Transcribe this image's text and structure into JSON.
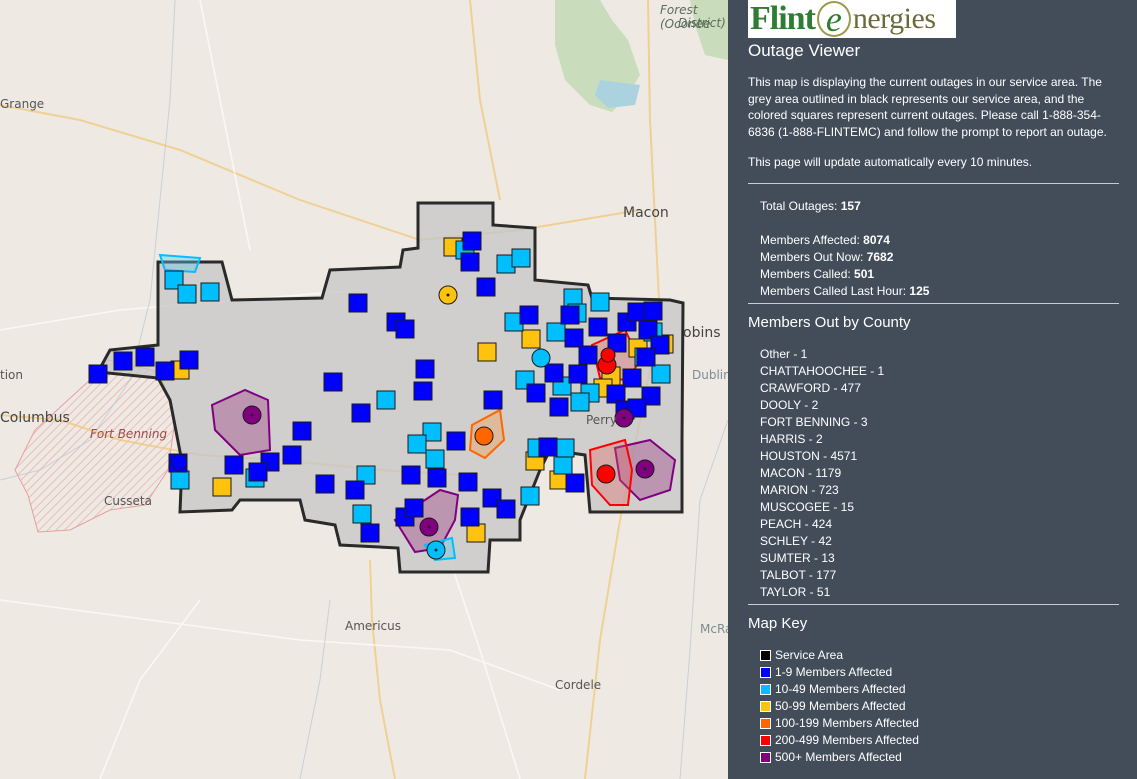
{
  "map": {
    "places": {
      "forest": "Forest (Oconee",
      "district": "District)",
      "grange": "Grange",
      "macon": "Macon",
      "robins": "obins",
      "dublin": "Dublin",
      "tion": "tion",
      "columbus": "Columbus",
      "fort_benning": "Fort Benning",
      "cusseta": "Cusseta",
      "perry": "Perry",
      "americus": "Americus",
      "cordele": "Cordele",
      "mcrae": "McRae"
    }
  },
  "panel": {
    "logo": {
      "part1": "Flint",
      "part2": "e",
      "part3": "nergies"
    },
    "title": "Outage Viewer",
    "description": "This map is displaying the current outages in our service area. The grey area outlined in black represents our service area, and the colored squares represent current outages. Please call 1-888-354-6836 (1-888-FLINTEMC) and follow the prompt to report an outage.",
    "update_note": "This page will update automatically every 10 minutes.",
    "stats": [
      {
        "label": "Total Outages:",
        "value": "157"
      },
      {
        "label": "Members Affected:",
        "value": "8074"
      },
      {
        "label": "Members Out Now:",
        "value": "7682"
      },
      {
        "label": "Members Called:",
        "value": "501"
      },
      {
        "label": "Members Called Last Hour:",
        "value": "125"
      }
    ],
    "county_heading": "Members Out by County",
    "counties": [
      "Other - 1",
      "CHATTAHOOCHEE - 1",
      "CRAWFORD - 477",
      "DOOLY - 2",
      "FORT BENNING - 3",
      "HARRIS - 2",
      "HOUSTON - 4571",
      "MACON - 1179",
      "MARION - 723",
      "MUSCOGEE - 15",
      "PEACH - 424",
      "SCHLEY - 42",
      "SUMTER - 13",
      "TALBOT - 177",
      "TAYLOR - 51"
    ],
    "key_heading": "Map Key",
    "key": [
      {
        "label": "Service Area",
        "color": "#000000"
      },
      {
        "label": "1-9 Members Affected",
        "color": "#0000ff"
      },
      {
        "label": "10-49 Members Affected",
        "color": "#00bfff"
      },
      {
        "label": "50-99 Members Affected",
        "color": "#ffc20e"
      },
      {
        "label": "100-199 Members Affected",
        "color": "#ff6600"
      },
      {
        "label": "200-499 Members Affected",
        "color": "#ff0000"
      },
      {
        "label": "500+ Members Affected",
        "color": "#800080"
      }
    ]
  }
}
